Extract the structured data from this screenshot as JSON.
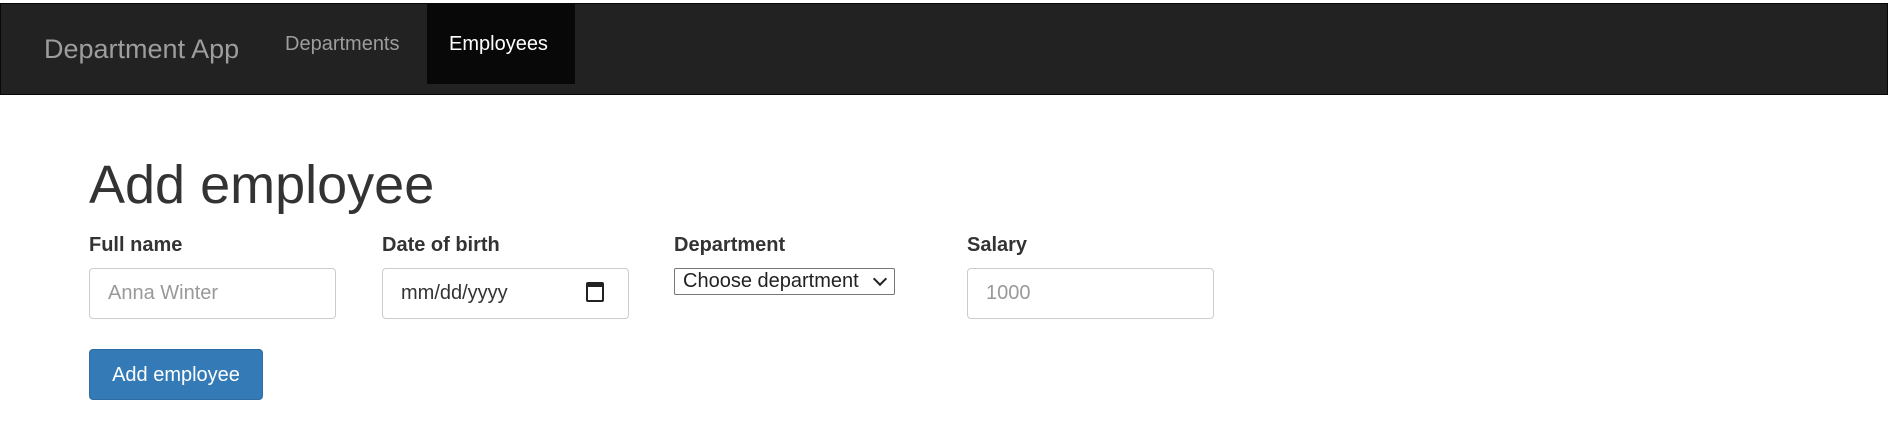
{
  "navbar": {
    "brand": "Department App",
    "items": [
      {
        "label": "Departments",
        "active": false
      },
      {
        "label": "Employees",
        "active": true
      }
    ]
  },
  "form": {
    "title": "Add employee",
    "fields": {
      "full_name": {
        "label": "Full name",
        "placeholder": "Anna Winter",
        "value": ""
      },
      "date_of_birth": {
        "label": "Date of birth",
        "value": "mm/dd/yyyy"
      },
      "department": {
        "label": "Department",
        "selected": "Choose department"
      },
      "salary": {
        "label": "Salary",
        "placeholder": "1000",
        "value": ""
      }
    },
    "submit_label": "Add employee"
  },
  "colors": {
    "navbar_bg": "#222222",
    "nav_active_bg": "#080808",
    "button_primary": "#337ab7"
  },
  "icons": [
    "calendar-icon",
    "chevron-down-icon"
  ]
}
